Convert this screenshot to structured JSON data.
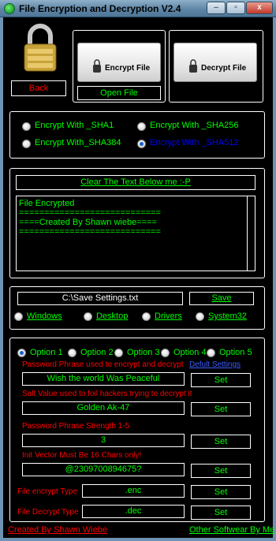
{
  "window": {
    "title": "File Encryption and Decryption V2.4",
    "minimize": "–",
    "maximize": "▫",
    "close": "x"
  },
  "top": {
    "back_label": "Back",
    "encrypt_file_label": "Encrypt File",
    "decrypt_file_label": "Decrypt File",
    "open_file_label": "Open File"
  },
  "hash": {
    "options": [
      {
        "label": "Encrypt With _SHA1",
        "selected": false
      },
      {
        "label": "Encrypt With _SHA256",
        "selected": false
      },
      {
        "label": "Encrypt With_SHA384",
        "selected": false
      },
      {
        "label": "Encrypt With _SHA512",
        "selected": true
      }
    ]
  },
  "text": {
    "clear_label": "Clear The Text Below me :-P",
    "lines": [
      "File Encrypted",
      "",
      "",
      "============================",
      "====Created By Shawn wiebe====",
      "============================"
    ]
  },
  "save": {
    "path_value": "C:\\Save Settings.txt",
    "save_label": "Save",
    "locations": [
      {
        "label": "Windows"
      },
      {
        "label": "Desktop"
      },
      {
        "label": "Drivers"
      },
      {
        "label": "System32"
      }
    ]
  },
  "settings": {
    "options": [
      {
        "label": "Option 1",
        "selected": true
      },
      {
        "label": "Option 2",
        "selected": false
      },
      {
        "label": "Option 3",
        "selected": false
      },
      {
        "label": "Option 4",
        "selected": false
      },
      {
        "label": "Option 5",
        "selected": false
      }
    ],
    "phrase_label": "Password Phrase used to encrypt and decrypt",
    "default_label": "Defult Settings",
    "phrase_value": "Wish the world Was Peaceful",
    "salt_label": "Salt Value used to foil hackers trying to decrypt it",
    "salt_value": "Golden Ak-47",
    "strength_label": "Password Phrase Strength 1-5",
    "strength_value": "3",
    "iv_label": "Init Vector Must Be 16 Chars only!",
    "iv_value": "@2309700894675?",
    "encrypt_type_label": "File encrypt Type",
    "encrypt_type_value": ".enc",
    "decrypt_type_label": "File Decrypt Type",
    "decrypt_type_value": ".dec",
    "set_label": "Set"
  },
  "footer": {
    "created_by": "Created By Shawn Wiebe",
    "other": "Other Softwear By Me"
  },
  "colors": {
    "accent_green": "#00ff00",
    "label_red": "#ff0000",
    "link_blue": "#0000ff"
  }
}
